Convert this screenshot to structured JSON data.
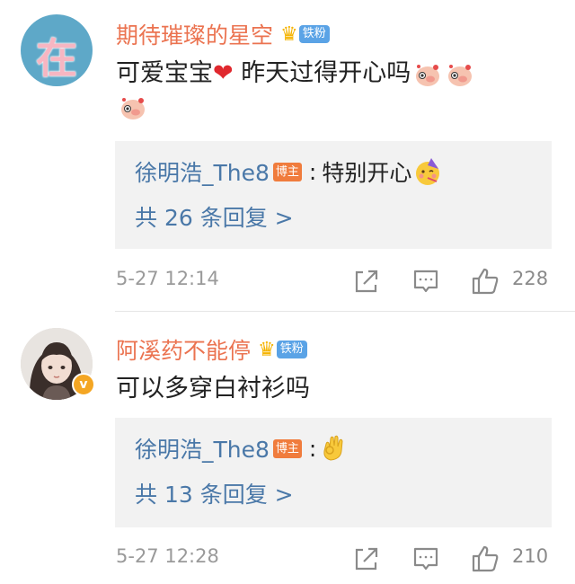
{
  "comments": [
    {
      "avatar_text": "在",
      "username": "期待璀璨的星空",
      "badge": "铁粉",
      "text_before_heart": "可爱宝宝",
      "heart": "❤",
      "text_after_heart": " 昨天过得开心吗",
      "reply": {
        "author": "徐明浩_The8",
        "host_badge": "博主",
        "colon": ":",
        "text": "特别开心",
        "count_label": "共 26 条回复 >"
      },
      "time": "5-27 12:14",
      "likes": "228"
    },
    {
      "username": "阿溪药不能停",
      "badge": "铁粉",
      "verified_mark": "v",
      "text": "可以多穿白衬衫吗",
      "reply": {
        "author": "徐明浩_The8",
        "host_badge": "博主",
        "colon": ":",
        "text": "",
        "count_label": "共 13 条回复 >"
      },
      "time": "5-27 12:28",
      "likes": "210"
    }
  ],
  "colors": {
    "username": "#eb7350",
    "link_blue": "#4a78a8",
    "reply_bg": "#f2f2f2",
    "meta_gray": "#9a9a9a",
    "fan_badge": "#5aa3e6",
    "host_badge": "#f07c3d"
  },
  "icons": [
    "crown-icon",
    "pig-emoji-icon",
    "party-face-emoji-icon",
    "ok-hand-emoji-icon",
    "share-icon",
    "comment-icon",
    "like-icon",
    "verified-icon"
  ]
}
